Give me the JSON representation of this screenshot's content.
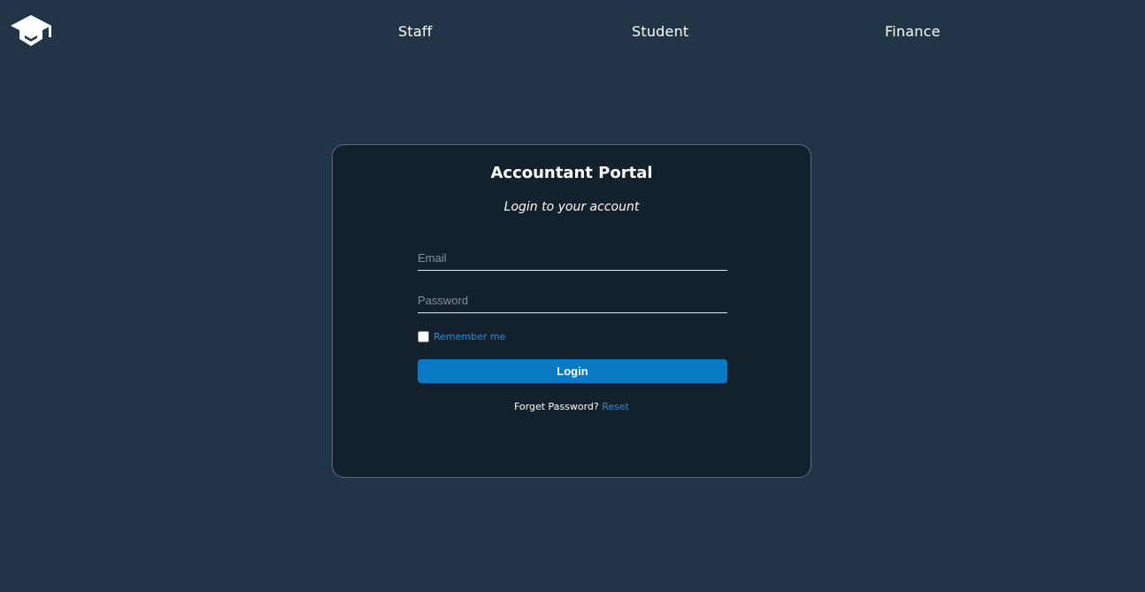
{
  "nav": {
    "logo": {
      "icon": "graduation-cap-icon",
      "color": "#ffffff"
    },
    "links": [
      "Staff",
      "Student",
      "Finance"
    ]
  },
  "login": {
    "title": "Accountant Portal",
    "subtitle": "Login to your account",
    "email_placeholder": "Email",
    "password_placeholder": "Password",
    "remember_label": "Remember me",
    "remember_checked": false,
    "login_button_label": "Login",
    "forgot_text": "Forget Password?",
    "reset_link_label": "Reset"
  },
  "colors": {
    "background": "#223447",
    "card_background": "#13212d",
    "accent": "#0a7ac6",
    "link": "#2a8fd6"
  }
}
